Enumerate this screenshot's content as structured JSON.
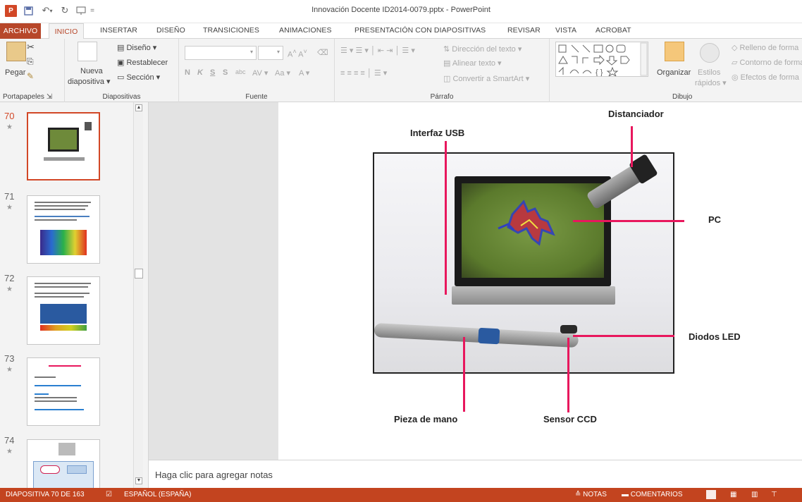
{
  "window": {
    "title": "Innovación Docente ID2014-0079.pptx - PowerPoint",
    "app_badge": "P"
  },
  "tabs": [
    "ARCHIVO",
    "INICIO",
    "INSERTAR",
    "DISEÑO",
    "TRANSICIONES",
    "ANIMACIONES",
    "PRESENTACIÓN CON DIAPOSITIVAS",
    "REVISAR",
    "VISTA",
    "ACROBAT"
  ],
  "ribbon": {
    "clipboard": {
      "paste": "Pegar",
      "label": "Portapapeles"
    },
    "slides": {
      "new_slide_1": "Nueva",
      "new_slide_2": "diapositiva",
      "layout": "Diseño",
      "reset": "Restablecer",
      "section": "Sección",
      "label": "Diapositivas"
    },
    "font": {
      "bold": "N",
      "italic": "K",
      "underline": "S",
      "strike": "S",
      "label": "Fuente",
      "case": "Aa"
    },
    "paragraph": {
      "text_direction": "Dirección del texto",
      "align_text": "Alinear texto",
      "smartart": "Convertir a SmartArt",
      "label": "Párrafo"
    },
    "drawing": {
      "arrange": "Organizar",
      "styles_1": "Estilos",
      "styles_2": "rápidos",
      "fill": "Relleno de forma",
      "outline": "Contorno de forma",
      "effects": "Efectos de forma",
      "label": "Dibujo"
    }
  },
  "thumbnails": [
    {
      "num": "70",
      "selected": true
    },
    {
      "num": "71",
      "selected": false
    },
    {
      "num": "72",
      "selected": false
    },
    {
      "num": "73",
      "selected": false
    },
    {
      "num": "74",
      "selected": false
    }
  ],
  "slide": {
    "labels": {
      "usb": "Interfaz USB",
      "spacer": "Distanciador",
      "pc": "PC",
      "leds": "Diodos LED",
      "handpiece": "Pieza de mano",
      "ccd": "Sensor CCD"
    }
  },
  "notes_placeholder": "Haga clic para agregar notas",
  "status": {
    "slide_info": "DIAPOSITIVA 70 DE 163",
    "language": "ESPAÑOL (ESPAÑA)",
    "notes": "NOTAS",
    "comments": "COMENTARIOS"
  },
  "colors": {
    "accent": "#b7472a",
    "status_bar": "#c3441f",
    "pointer_lines": "#e8175d"
  }
}
